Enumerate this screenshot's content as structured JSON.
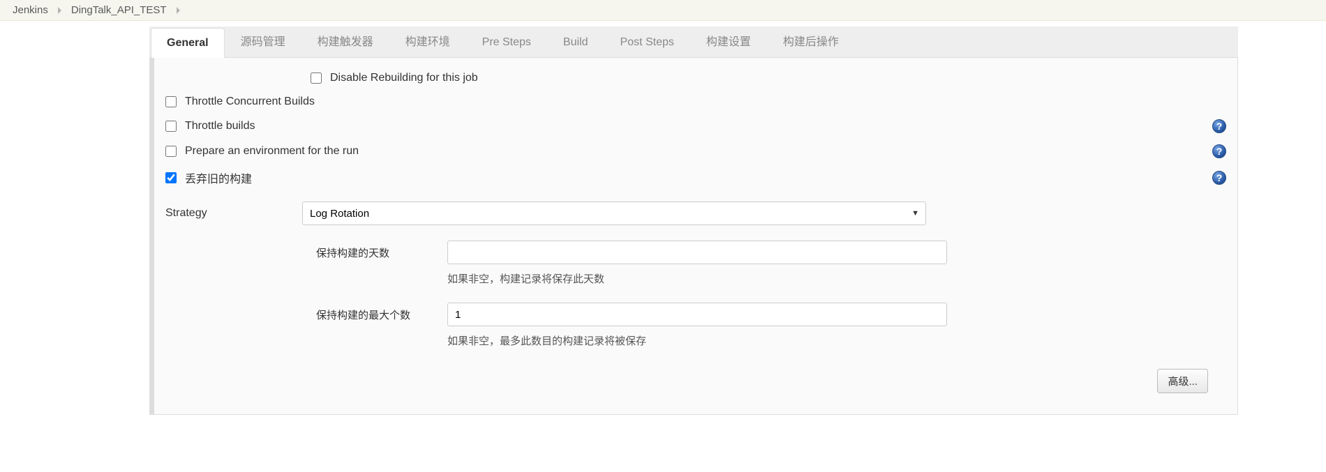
{
  "breadcrumb": {
    "root": "Jenkins",
    "job": "DingTalk_API_TEST"
  },
  "tabs": [
    {
      "label": "General",
      "active": true
    },
    {
      "label": "源码管理",
      "active": false
    },
    {
      "label": "构建触发器",
      "active": false
    },
    {
      "label": "构建环境",
      "active": false
    },
    {
      "label": "Pre Steps",
      "active": false
    },
    {
      "label": "Build",
      "active": false
    },
    {
      "label": "Post Steps",
      "active": false
    },
    {
      "label": "构建设置",
      "active": false
    },
    {
      "label": "构建后操作",
      "active": false
    }
  ],
  "options": {
    "disable_rebuild": {
      "label": "Disable Rebuilding for this job",
      "checked": false
    },
    "throttle_concurrent": {
      "label": "Throttle Concurrent Builds",
      "checked": false
    },
    "throttle_builds": {
      "label": "Throttle builds",
      "checked": false
    },
    "prepare_env": {
      "label": "Prepare an environment for the run",
      "checked": false
    },
    "discard_old": {
      "label": "丢弃旧的构建",
      "checked": true
    }
  },
  "discard": {
    "strategy_label": "Strategy",
    "strategy_value": "Log Rotation",
    "days": {
      "label": "保持构建的天数",
      "value": "",
      "hint": "如果非空，构建记录将保存此天数"
    },
    "max": {
      "label": "保持构建的最大个数",
      "value": "1",
      "hint": "如果非空，最多此数目的构建记录将被保存"
    },
    "advanced_label": "高级..."
  }
}
